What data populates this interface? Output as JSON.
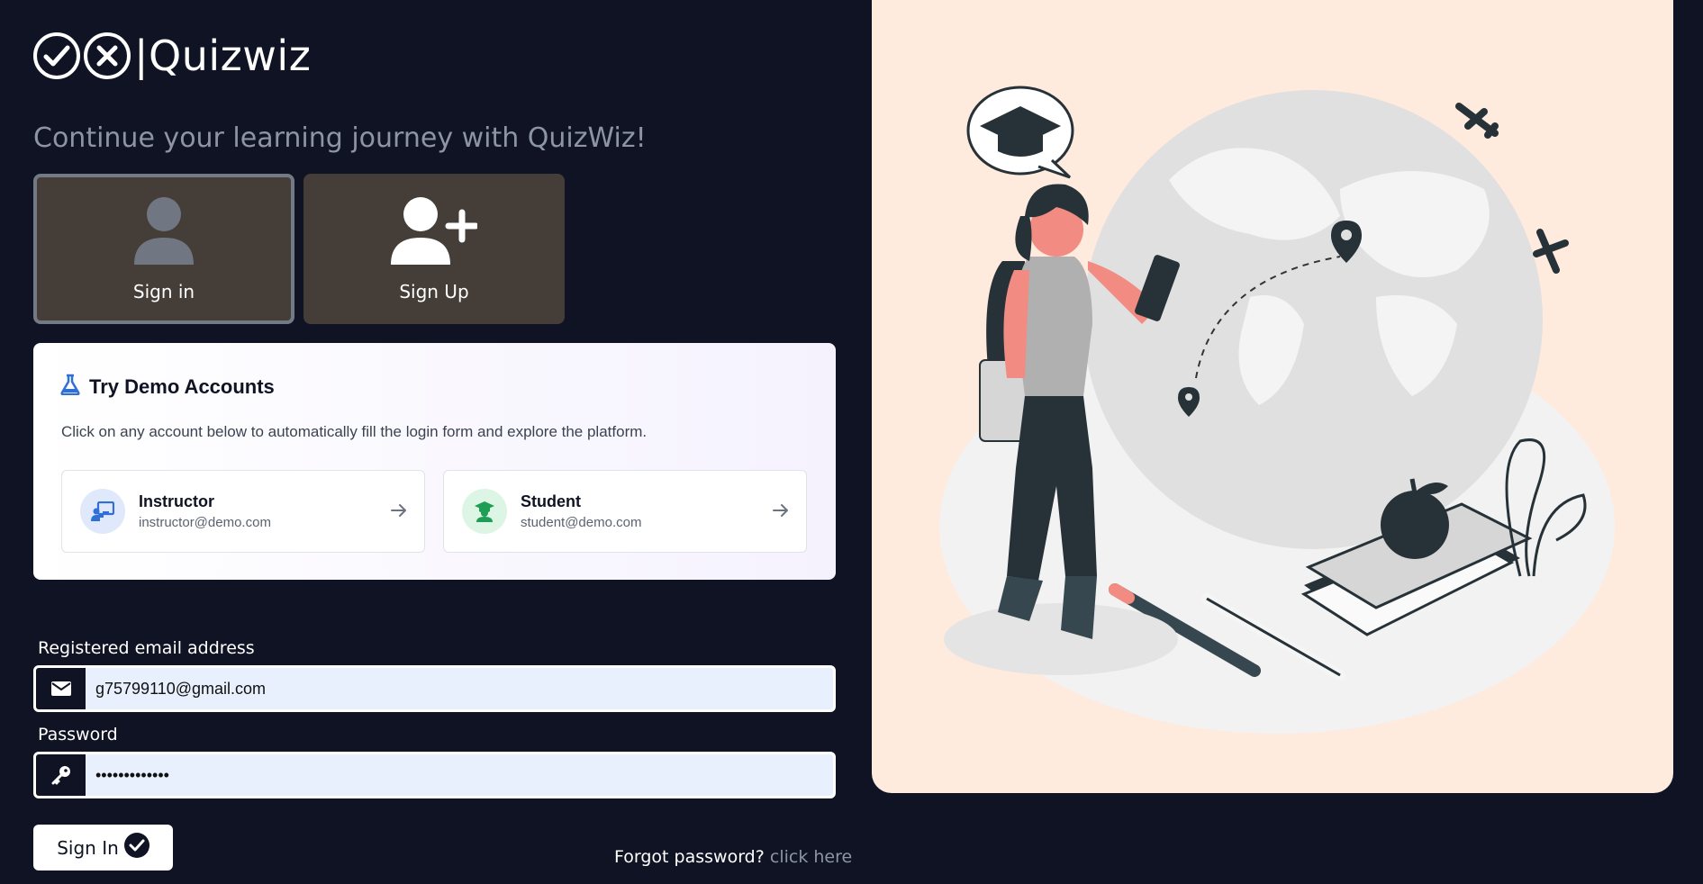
{
  "logo": {
    "text": "|Quizwiz"
  },
  "tagline": "Continue your learning journey with QuizWiz!",
  "modes": [
    {
      "label": "Sign in",
      "icon": "user-icon",
      "active": true
    },
    {
      "label": "Sign Up",
      "icon": "user-plus-icon",
      "active": false
    }
  ],
  "demo": {
    "title": "Try Demo Accounts",
    "description": "Click on any account below to automatically fill the login form and explore the platform.",
    "accounts": [
      {
        "role": "Instructor",
        "email": "instructor@demo.com",
        "icon": "chalkboard-teacher-icon",
        "color": "#2f6fd6"
      },
      {
        "role": "Student",
        "email": "student@demo.com",
        "icon": "graduate-icon",
        "color": "#1f9d55"
      }
    ]
  },
  "form": {
    "email_label": "Registered email address",
    "email_value": "g75799110@gmail.com",
    "password_label": "Password",
    "password_value": "•••••••••••••",
    "submit_label": "Sign In",
    "forgot_text": "Forgot password?",
    "forgot_link": "click here"
  },
  "colors": {
    "background": "#0f1323",
    "tile": "#453e38",
    "panel": "#ffeade"
  }
}
